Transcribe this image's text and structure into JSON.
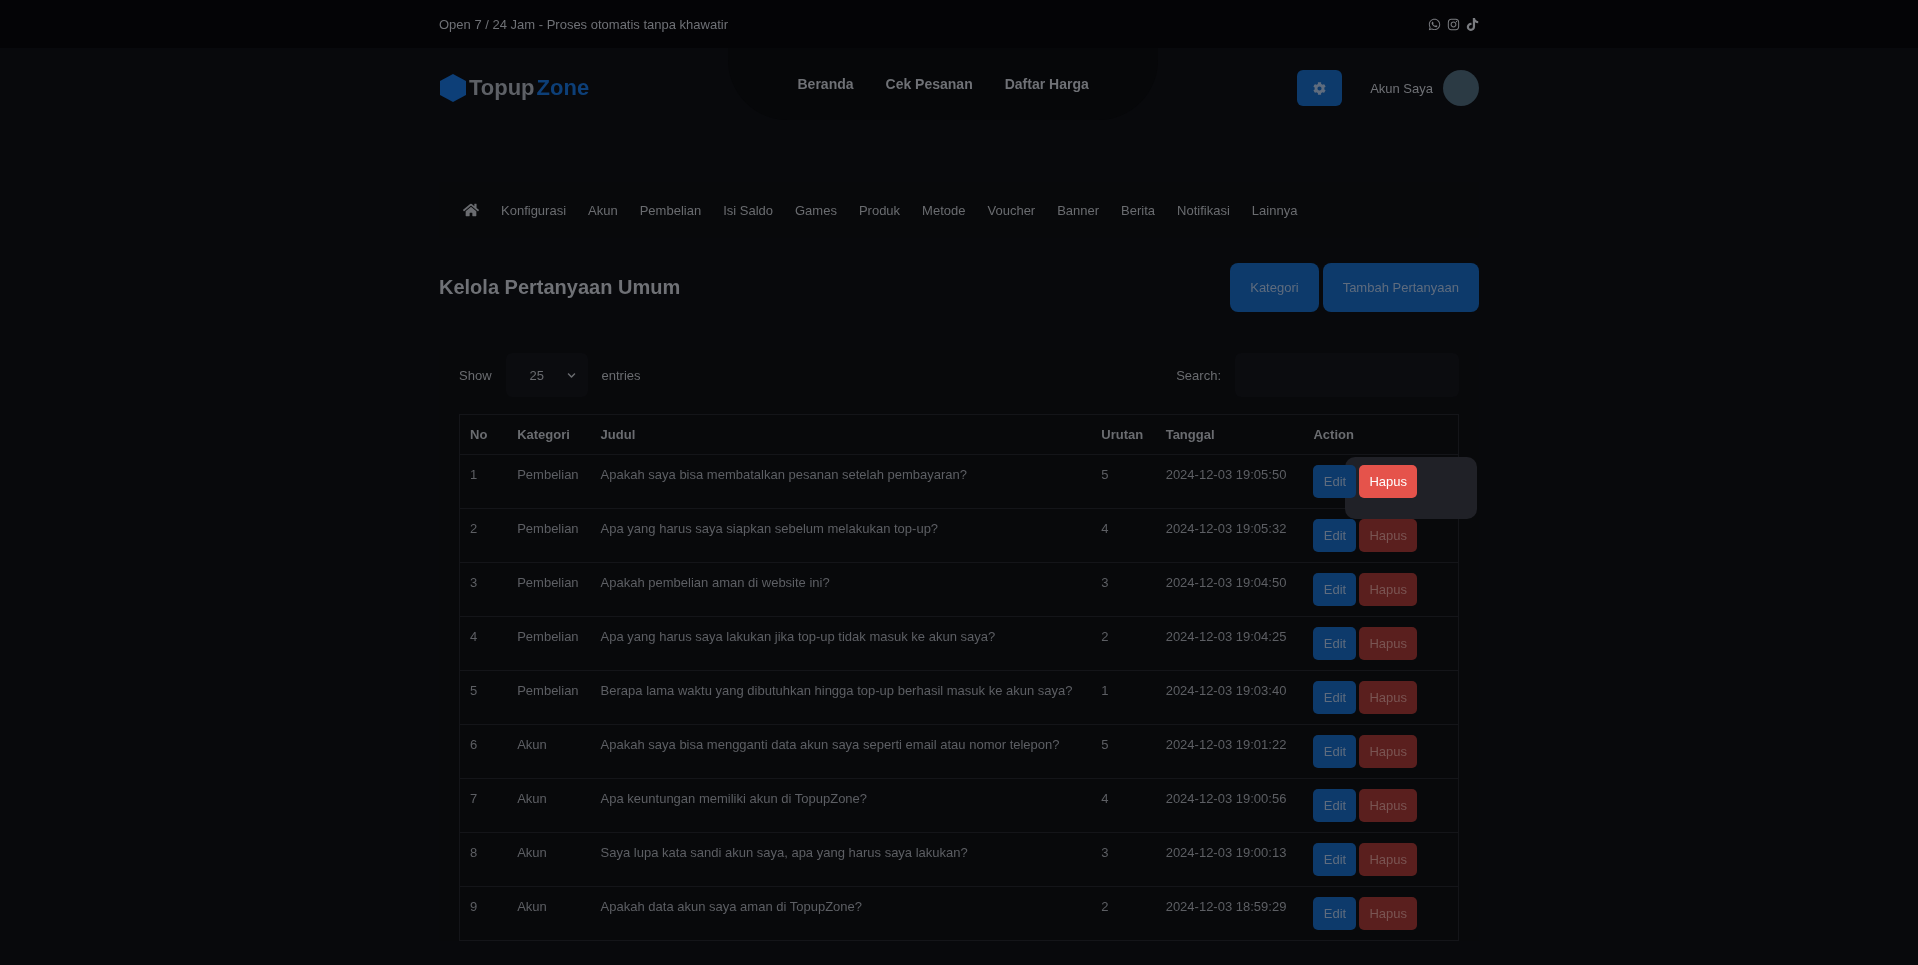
{
  "top_bar": {
    "tagline": "Open 7 / 24 Jam - Proses otomatis tanpa khawatir"
  },
  "header": {
    "logo": {
      "part_1": "Topup",
      "part_2": "Zone"
    },
    "nav": [
      "Beranda",
      "Cek Pesanan",
      "Daftar Harga"
    ],
    "account_label": "Akun Saya"
  },
  "admin_menu": [
    "Konfigurasi",
    "Akun",
    "Pembelian",
    "Isi Saldo",
    "Games",
    "Produk",
    "Metode",
    "Voucher",
    "Banner",
    "Berita",
    "Notifikasi",
    "Lainnya"
  ],
  "page_title": "Kelola Pertanyaan Umum",
  "page_buttons": [
    "Kategori",
    "Tambah Pertanyaan"
  ],
  "table_controls": {
    "show_label": "Show",
    "page_size": "25",
    "entries_label": "entries",
    "search_label": "Search:"
  },
  "table": {
    "columns": [
      "No",
      "Kategori",
      "Judul",
      "Urutan",
      "Tanggal",
      "Action"
    ],
    "rows": [
      {
        "no": "1",
        "kategori": "Pembelian",
        "judul": "Apakah saya bisa membatalkan pesanan setelah pembayaran?",
        "urutan": "5",
        "tanggal": "2024-12-03 19:05:50",
        "spotlight": true,
        "actions": [
          {
            "label": "Edit",
            "kind": "edit"
          },
          {
            "label": "Hapus",
            "kind": "delete"
          }
        ]
      },
      {
        "no": "2",
        "kategori": "Pembelian",
        "judul": "Apa yang harus saya siapkan sebelum melakukan top-up?",
        "urutan": "4",
        "tanggal": "2024-12-03 19:05:32",
        "spotlight": false,
        "actions": [
          {
            "label": "Edit",
            "kind": "edit"
          },
          {
            "label": "Hapus",
            "kind": "delete"
          }
        ]
      },
      {
        "no": "3",
        "kategori": "Pembelian",
        "judul": "Apakah pembelian aman di website ini?",
        "urutan": "3",
        "tanggal": "2024-12-03 19:04:50",
        "spotlight": false,
        "actions": [
          {
            "label": "Edit",
            "kind": "edit"
          },
          {
            "label": "Hapus",
            "kind": "delete"
          }
        ]
      },
      {
        "no": "4",
        "kategori": "Pembelian",
        "judul": "Apa yang harus saya lakukan jika top-up tidak masuk ke akun saya?",
        "urutan": "2",
        "tanggal": "2024-12-03 19:04:25",
        "spotlight": false,
        "actions": [
          {
            "label": "Edit",
            "kind": "edit"
          },
          {
            "label": "Hapus",
            "kind": "delete"
          }
        ]
      },
      {
        "no": "5",
        "kategori": "Pembelian",
        "judul": "Berapa lama waktu yang dibutuhkan hingga top-up berhasil masuk ke akun saya?",
        "urutan": "1",
        "tanggal": "2024-12-03 19:03:40",
        "spotlight": false,
        "actions": [
          {
            "label": "Edit",
            "kind": "edit"
          },
          {
            "label": "Hapus",
            "kind": "delete"
          }
        ]
      },
      {
        "no": "6",
        "kategori": "Akun",
        "judul": "Apakah saya bisa mengganti data akun saya seperti email atau nomor telepon?",
        "urutan": "5",
        "tanggal": "2024-12-03 19:01:22",
        "spotlight": false,
        "actions": [
          {
            "label": "Edit",
            "kind": "edit"
          },
          {
            "label": "Hapus",
            "kind": "delete"
          }
        ]
      },
      {
        "no": "7",
        "kategori": "Akun",
        "judul": "Apa keuntungan memiliki akun di TopupZone?",
        "urutan": "4",
        "tanggal": "2024-12-03 19:00:56",
        "spotlight": false,
        "actions": [
          {
            "label": "Edit",
            "kind": "edit"
          },
          {
            "label": "Hapus",
            "kind": "delete"
          }
        ]
      },
      {
        "no": "8",
        "kategori": "Akun",
        "judul": "Saya lupa kata sandi akun saya, apa yang harus saya lakukan?",
        "urutan": "3",
        "tanggal": "2024-12-03 19:00:13",
        "spotlight": false,
        "actions": [
          {
            "label": "Edit",
            "kind": "edit"
          },
          {
            "label": "Hapus",
            "kind": "delete"
          }
        ]
      },
      {
        "no": "9",
        "kategori": "Akun",
        "judul": "Apakah data akun saya aman di TopupZone?",
        "urutan": "2",
        "tanggal": "2024-12-03 18:59:29",
        "spotlight": false,
        "actions": [
          {
            "label": "Edit",
            "kind": "edit"
          },
          {
            "label": "Hapus",
            "kind": "delete"
          }
        ]
      }
    ]
  }
}
